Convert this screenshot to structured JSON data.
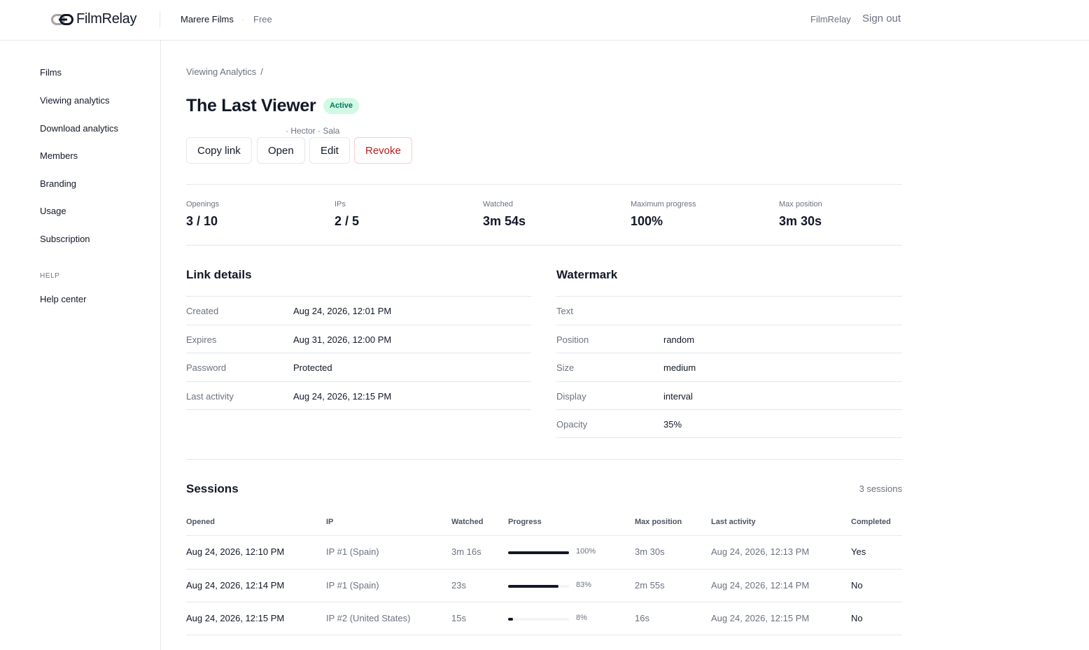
{
  "brand": {
    "name": "FilmRelay"
  },
  "topbar": {
    "org": "Marere Films",
    "separator": "·",
    "plan": "Free",
    "product_link": "FilmRelay",
    "signout": "Sign out"
  },
  "sidebar": {
    "items": [
      "Films",
      "Viewing analytics",
      "Download analytics",
      "Members",
      "Branding",
      "Usage",
      "Subscription"
    ],
    "help_heading": "HELP",
    "help_items": [
      "Help center"
    ]
  },
  "breadcrumb": {
    "parent": "Viewing Analytics",
    "sep": "/"
  },
  "page": {
    "title": "The Last Viewer",
    "status": "Active",
    "subline": "· Hector · Sala"
  },
  "actions": {
    "copy": "Copy link",
    "open": "Open",
    "edit": "Edit",
    "revoke": "Revoke"
  },
  "stats": [
    {
      "label": "Openings",
      "value": "3 / 10"
    },
    {
      "label": "IPs",
      "value": "2 / 5"
    },
    {
      "label": "Watched",
      "value": "3m 54s"
    },
    {
      "label": "Maximum progress",
      "value": "100%"
    },
    {
      "label": "Max position",
      "value": "3m 30s"
    }
  ],
  "link_details": {
    "title": "Link details",
    "rows": [
      {
        "key": "Created",
        "value": "Aug 24, 2026, 12:01 PM"
      },
      {
        "key": "Expires",
        "value": "Aug 31, 2026, 12:00 PM"
      },
      {
        "key": "Password",
        "value": "Protected"
      },
      {
        "key": "Last activity",
        "value": "Aug 24, 2026, 12:15 PM"
      }
    ]
  },
  "watermark": {
    "title": "Watermark",
    "rows": [
      {
        "key": "Text",
        "value": ""
      },
      {
        "key": "Position",
        "value": "random"
      },
      {
        "key": "Size",
        "value": "medium"
      },
      {
        "key": "Display",
        "value": "interval"
      },
      {
        "key": "Opacity",
        "value": "35%"
      }
    ]
  },
  "sessions": {
    "title": "Sessions",
    "count": "3 sessions",
    "columns": [
      "Opened",
      "IP",
      "Watched",
      "Progress",
      "Max position",
      "Last activity",
      "Completed"
    ],
    "rows": [
      {
        "opened": "Aug 24, 2026, 12:10 PM",
        "ip": "IP #1 (Spain)",
        "watched": "3m 16s",
        "progress": 100,
        "progress_label": "100%",
        "max_position": "3m 30s",
        "last_activity": "Aug 24, 2026, 12:13 PM",
        "completed": "Yes"
      },
      {
        "opened": "Aug 24, 2026, 12:14 PM",
        "ip": "IP #1 (Spain)",
        "watched": "23s",
        "progress": 83,
        "progress_label": "83%",
        "max_position": "2m 55s",
        "last_activity": "Aug 24, 2026, 12:14 PM",
        "completed": "No"
      },
      {
        "opened": "Aug 24, 2026, 12:15 PM",
        "ip": "IP #2 (United States)",
        "watched": "15s",
        "progress": 8,
        "progress_label": "8%",
        "max_position": "16s",
        "last_activity": "Aug 24, 2026, 12:15 PM",
        "completed": "No"
      }
    ]
  },
  "colors": {
    "accent": "#111827",
    "active_bg": "#d1fae5",
    "active_text": "#047857",
    "danger": "#b91c1c",
    "logo_mark": "#a8a29e"
  }
}
